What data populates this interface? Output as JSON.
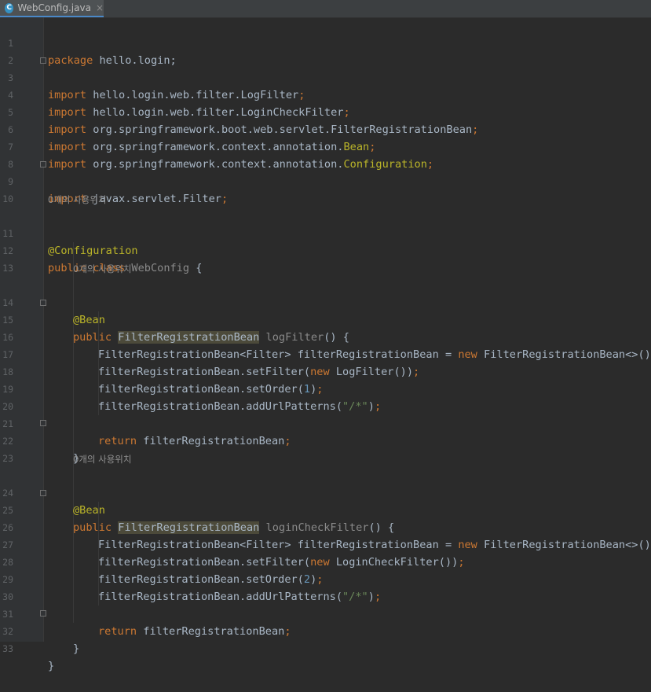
{
  "tab": {
    "icon": "C",
    "filename": "WebConfig.java",
    "close": "×"
  },
  "usage_hint": "0개의 사용위치",
  "lines": {
    "l1": {
      "no": "1",
      "kw": "package",
      "rest": " hello.login;"
    },
    "l2": {
      "no": "2"
    },
    "l3": {
      "no": "3",
      "kw": "import",
      "pkg": " hello.login.web.filter.LogFilter",
      "semi": ";"
    },
    "l4": {
      "no": "4",
      "kw": "import",
      "pkg": " hello.login.web.filter.LoginCheckFilter",
      "semi": ";"
    },
    "l5": {
      "no": "5",
      "kw": "import",
      "pkg": " org.springframework.boot.web.servlet.FilterRegistrationBean",
      "semi": ";"
    },
    "l6": {
      "no": "6",
      "kw": "import",
      "pkg": " org.springframework.context.annotation.",
      "cls": "Bean",
      "semi": ";"
    },
    "l7": {
      "no": "7",
      "kw": "import",
      "pkg": " org.springframework.context.annotation.",
      "cls": "Configuration",
      "semi": ";"
    },
    "l8": {
      "no": "8"
    },
    "l9": {
      "no": "9",
      "kw": "import",
      "pkg": " javax.servlet.Filter",
      "semi": ";"
    },
    "l10": {
      "no": "10"
    },
    "l11": {
      "no": "11",
      "ann": "@Configuration"
    },
    "l12": {
      "no": "12",
      "kw": "public class",
      "name": " WebConfig",
      "rest": " {"
    },
    "l13": {
      "no": "13"
    },
    "l14": {
      "no": "14",
      "ann": "@Bean"
    },
    "l15": {
      "no": "15",
      "kw": "public",
      "type": "FilterRegistrationBean",
      "name": " logFilter",
      "rest": "() {"
    },
    "l16": {
      "no": "16",
      "a": "FilterRegistrationBean<Filter> filterRegistrationBean = ",
      "kw": "new",
      "b": " FilterRegistrationBean<>()",
      "semi": ";"
    },
    "l17": {
      "no": "17",
      "a": "filterRegistrationBean.setFilter(",
      "kw": "new",
      "b": " LogFilter())",
      "semi": ";"
    },
    "l18": {
      "no": "18",
      "a": "filterRegistrationBean.setOrder(",
      "num": "1",
      "b": ")",
      "semi": ";"
    },
    "l19": {
      "no": "19",
      "a": "filterRegistrationBean.addUrlPatterns(",
      "str": "\"/*\"",
      "b": ")",
      "semi": ";"
    },
    "l20": {
      "no": "20"
    },
    "l21": {
      "no": "21",
      "kw": "return",
      "a": " filterRegistrationBean",
      "semi": ";"
    },
    "l22": {
      "no": "22",
      "rest": "}"
    },
    "l23": {
      "no": "23"
    },
    "l24": {
      "no": "24",
      "ann": "@Bean"
    },
    "l25": {
      "no": "25",
      "kw": "public",
      "type": "FilterRegistrationBean",
      "name": " loginCheckFilter",
      "rest": "() {"
    },
    "l26": {
      "no": "26",
      "a": "FilterRegistrationBean<Filter> filterRegistrationBean = ",
      "kw": "new",
      "b": " FilterRegistrationBean<>()",
      "semi": ";"
    },
    "l27": {
      "no": "27",
      "a": "filterRegistrationBean.setFilter(",
      "kw": "new",
      "b": " LoginCheckFilter())",
      "semi": ";"
    },
    "l28": {
      "no": "28",
      "a": "filterRegistrationBean.setOrder(",
      "num": "2",
      "b": ")",
      "semi": ";"
    },
    "l29": {
      "no": "29",
      "a": "filterRegistrationBean.addUrlPatterns(",
      "str": "\"/*\"",
      "b": ")",
      "semi": ";"
    },
    "l30": {
      "no": "30"
    },
    "l31": {
      "no": "31",
      "kw": "return",
      "a": " filterRegistrationBean",
      "semi": ";"
    },
    "l32": {
      "no": "32",
      "rest": "}"
    },
    "l33": {
      "no": "33",
      "rest": "}"
    }
  },
  "colors": {
    "background": "#2b2b2b",
    "keyword": "#cc7832",
    "annotation": "#bbb529",
    "number": "#6897bb",
    "string": "#6a8759",
    "text": "#a9b7c6",
    "highlight": "#4c4a3a"
  }
}
